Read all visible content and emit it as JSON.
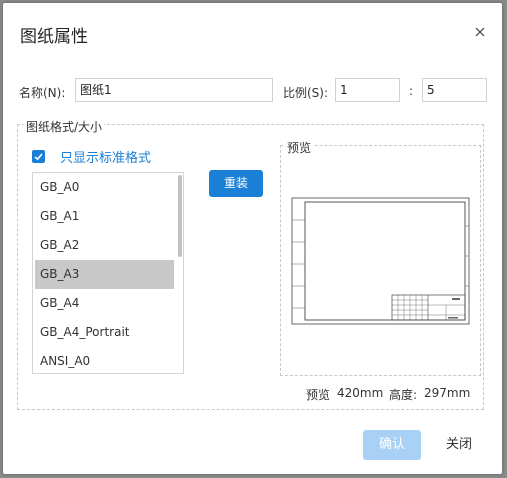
{
  "dialog": {
    "title": "图纸属性"
  },
  "form": {
    "name_label": "名称(N):",
    "name_value": "图纸1",
    "scale_label": "比例(S):",
    "scale_numerator": "1",
    "scale_separator": ":",
    "scale_denominator": "5"
  },
  "format": {
    "group_label": "图纸格式/大小",
    "standard_only_label": "只显示标准格式",
    "standard_only_checked": true,
    "items": [
      "GB_A0",
      "GB_A1",
      "GB_A2",
      "GB_A3",
      "GB_A4",
      "GB_A4_Portrait",
      "ANSI_A0"
    ],
    "selected_item": "GB_A3",
    "reload_label": "重装"
  },
  "preview": {
    "label": "预览",
    "width_label": "预览",
    "width_value": "420mm",
    "height_label": "高度:",
    "height_value": "297mm"
  },
  "footer": {
    "ok_label": "确认",
    "close_label": "关闭"
  },
  "colors": {
    "accent": "#1a7fd6",
    "accent_disabled": "#a9d1f6",
    "selection": "#c8c8c8"
  }
}
